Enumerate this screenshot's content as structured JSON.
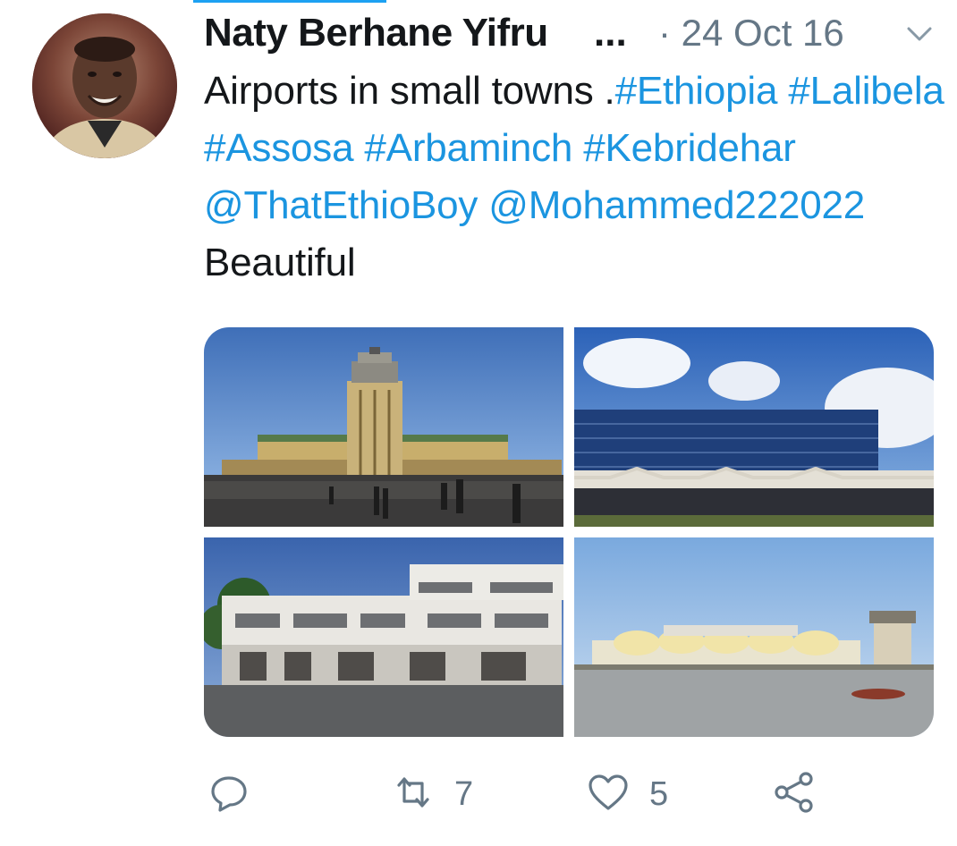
{
  "tweet": {
    "author_name": "Naty Berhane Yifru",
    "name_ellipsis": "...",
    "date": "· 24 Oct 16",
    "text_parts": [
      {
        "text": "Airports in small towns .",
        "kind": "text"
      },
      {
        "text": "#Ethiopia",
        "kind": "hashtag"
      },
      {
        "text": " ",
        "kind": "text"
      },
      {
        "text": "#Lalibela",
        "kind": "hashtag"
      },
      {
        "text": " ",
        "kind": "text"
      },
      {
        "text": "#Assosa",
        "kind": "hashtag"
      },
      {
        "text": " ",
        "kind": "text"
      },
      {
        "text": "#Arbaminch",
        "kind": "hashtag"
      },
      {
        "text": " ",
        "kind": "text"
      },
      {
        "text": "#Kebridehar",
        "kind": "hashtag"
      },
      {
        "text": " ",
        "kind": "text"
      },
      {
        "text": "@ThatEthioBoy",
        "kind": "mention"
      },
      {
        "text": " ",
        "kind": "text"
      },
      {
        "text": "@Mohammed222022",
        "kind": "mention"
      },
      {
        "text": " Beautiful",
        "kind": "text"
      }
    ],
    "photos": [
      {
        "icon": "airport-tower-photo"
      },
      {
        "icon": "glass-terminal-photo"
      },
      {
        "icon": "white-terminal-photo"
      },
      {
        "icon": "arched-terminal-photo"
      }
    ]
  },
  "actions": {
    "reply": {
      "icon": "reply-icon",
      "count": ""
    },
    "retweet": {
      "icon": "retweet-icon",
      "count": "7"
    },
    "like": {
      "icon": "heart-icon",
      "count": "5"
    },
    "share": {
      "icon": "share-icon",
      "count": ""
    }
  },
  "colors": {
    "link": "#1b95e0",
    "text": "#14171a",
    "secondary": "#657786",
    "accent": "#1da1f2"
  }
}
